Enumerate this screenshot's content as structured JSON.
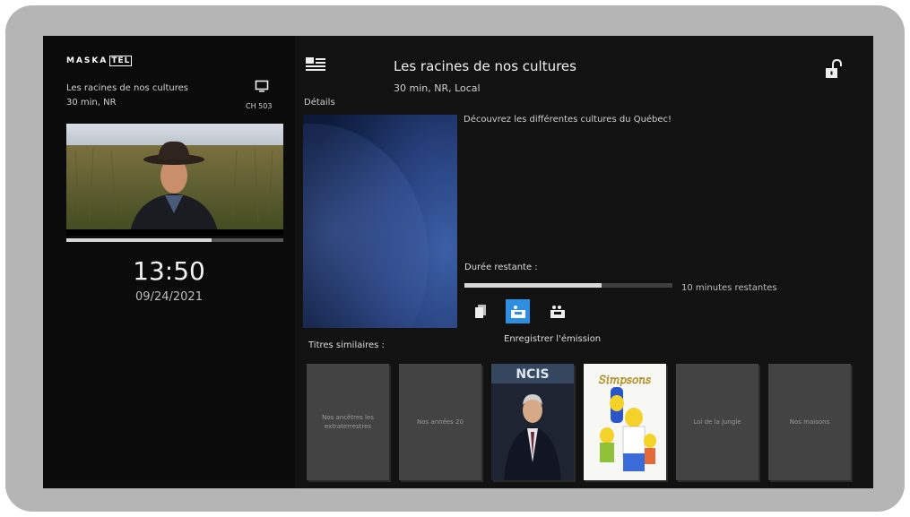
{
  "brand": {
    "logo_main": "MASKA",
    "logo_box": "TEL"
  },
  "now_playing": {
    "title": "Les racines de nos cultures",
    "meta": "30 min, NR",
    "channel": "CH 503",
    "progress": 0.67,
    "time": "13:50",
    "date": "09/24/2021"
  },
  "details": {
    "label": "Détails",
    "title": "Les racines de nos cultures",
    "meta": "30 min, NR, Local",
    "description": "Découvrez les différentes cultures du Québec!",
    "remaining_label": "Durée restante :",
    "remaining_progress": 0.66,
    "remaining_text": "10 minutes restantes",
    "record_label": "Enregistrer l'émission"
  },
  "similar": {
    "label": "Titres similaires :",
    "items": [
      {
        "title": "Nos ancêtres les extraterrestres"
      },
      {
        "title": "Nos années 20"
      },
      {
        "title": "NCIS"
      },
      {
        "title": "Les Simpson"
      },
      {
        "title": "Loi de la jungle"
      },
      {
        "title": "Nos maisons"
      }
    ]
  },
  "colors": {
    "accent": "#2e8fe0",
    "background": "#121212",
    "frame": "#b5b5b5"
  },
  "icons": [
    "tv-icon",
    "details-icon",
    "unlock-icon",
    "copy-icon",
    "record-icon",
    "record-series-icon"
  ]
}
